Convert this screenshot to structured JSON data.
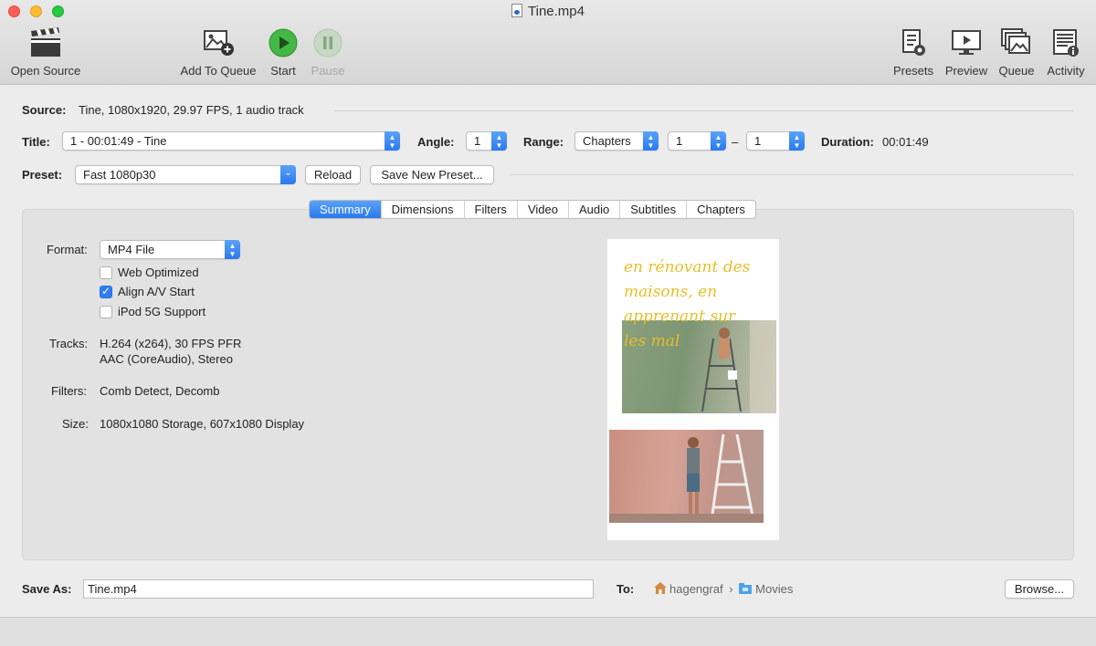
{
  "window": {
    "title": "Tine.mp4"
  },
  "toolbar": {
    "open_source": "Open Source",
    "add_to_queue": "Add To Queue",
    "start": "Start",
    "pause": "Pause",
    "presets": "Presets",
    "preview": "Preview",
    "queue": "Queue",
    "activity": "Activity"
  },
  "source": {
    "label": "Source:",
    "value": "Tine, 1080x1920, 29.97 FPS, 1 audio track"
  },
  "title_row": {
    "title_label": "Title:",
    "title_value": "1 - 00:01:49 - Tine",
    "angle_label": "Angle:",
    "angle_value": "1",
    "range_label": "Range:",
    "range_type": "Chapters",
    "range_start": "1",
    "range_sep": "–",
    "range_end": "1",
    "duration_label": "Duration:",
    "duration_value": "00:01:49"
  },
  "preset_row": {
    "label": "Preset:",
    "value": "Fast 1080p30",
    "reload": "Reload",
    "save_new": "Save New Preset..."
  },
  "tabs": [
    {
      "label": "Summary",
      "active": true
    },
    {
      "label": "Dimensions"
    },
    {
      "label": "Filters"
    },
    {
      "label": "Video"
    },
    {
      "label": "Audio"
    },
    {
      "label": "Subtitles"
    },
    {
      "label": "Chapters"
    }
  ],
  "summary": {
    "format_label": "Format:",
    "format_value": "MP4 File",
    "web_optimized": {
      "label": "Web Optimized",
      "checked": false
    },
    "align_av": {
      "label": "Align A/V Start",
      "checked": true
    },
    "ipod": {
      "label": "iPod 5G Support",
      "checked": false
    },
    "tracks_label": "Tracks:",
    "tracks_line1": "H.264 (x264), 30 FPS PFR",
    "tracks_line2": "AAC (CoreAudio), Stereo",
    "filters_label": "Filters:",
    "filters_value": "Comb Detect, Decomb",
    "size_label": "Size:",
    "size_value": "1080x1080 Storage, 607x1080 Display"
  },
  "preview_text": {
    "line1": "en rénovant des",
    "line2": "maisons, en",
    "line3": "apprenant sur",
    "line4": "les mal"
  },
  "save_row": {
    "label": "Save As:",
    "filename": "Tine.mp4",
    "to_label": "To:",
    "path_user": "hagengraf",
    "path_folder": "Movies",
    "browse": "Browse..."
  },
  "colors": {
    "accent": "#2f7df2",
    "start_green": "#3fb13f"
  }
}
